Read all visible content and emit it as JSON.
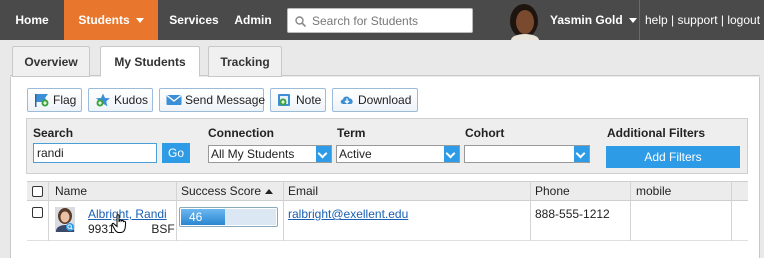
{
  "topnav": {
    "home": "Home",
    "students": "Students",
    "services": "Services",
    "admin": "Admin",
    "search_placeholder": "Search for Students",
    "user_name": "Yasmin Gold",
    "help": "help",
    "support": "support",
    "logout": "logout",
    "separator": "|"
  },
  "tabs": [
    {
      "label": "Overview",
      "active": false
    },
    {
      "label": "My Students",
      "active": true
    },
    {
      "label": "Tracking",
      "active": false
    }
  ],
  "toolbar": {
    "flag": "Flag",
    "kudos": "Kudos",
    "send_message": "Send Message",
    "note": "Note",
    "download": "Download"
  },
  "filters": {
    "search_label": "Search",
    "search_value": "randi",
    "go": "Go",
    "connection_label": "Connection",
    "connection_value": "All My Students",
    "term_label": "Term",
    "term_value": "Active",
    "cohort_label": "Cohort",
    "cohort_value": "",
    "additional_label": "Additional Filters",
    "add_filters_button": "Add Filters"
  },
  "table": {
    "columns": [
      "Name",
      "Success Score",
      "Email",
      "Phone",
      "mobile"
    ],
    "sort_column": "Success Score",
    "sort_direction": "ascending",
    "rows": [
      {
        "name": "Albright, Randi",
        "id": "9931           BSF",
        "success_score": 46,
        "score_fraction": 0.46,
        "email": "ralbright@exellent.edu",
        "phone": "888-555-1212",
        "mobile": ""
      }
    ]
  },
  "colors": {
    "nav_bg": "#4a4a4a",
    "nav_active": "#e8762c",
    "accent_blue": "#2e9be6",
    "link_blue": "#1a5fb4"
  },
  "icons": {
    "flag": "flag-icon",
    "kudos": "star-plus-icon",
    "send_message": "envelope-icon",
    "note": "note-plus-icon",
    "download": "cloud-download-icon",
    "search": "search-icon"
  }
}
